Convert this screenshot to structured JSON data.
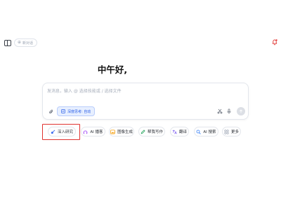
{
  "header": {
    "new_chat_label": "新对话",
    "sidebar_icon": "sidebar-toggle-icon",
    "notification_icon": "bell-icon"
  },
  "greeting": "中午好,",
  "composer": {
    "placeholder": "发消息，输入 @ 选择技能或 / 选择文件",
    "deep_think_label": "深度思考: 自动",
    "attach_icon": "paperclip-icon",
    "scissors_icon": "scissors-icon",
    "mic_icon": "microphone-icon",
    "send_icon": "send-icon"
  },
  "actions": [
    {
      "label": "深入研究",
      "icon": "research-icon",
      "color": "#3b6cf0"
    },
    {
      "label": "AI 播客",
      "icon": "podcast-icon",
      "color": "#a855f7"
    },
    {
      "label": "图像生成",
      "icon": "image-icon",
      "color": "#f59e0b"
    },
    {
      "label": "帮我写作",
      "icon": "pen-icon",
      "color": "#22a35a"
    },
    {
      "label": "翻译",
      "icon": "translate-icon",
      "color": "#7c5cf0"
    },
    {
      "label": "AI 搜索",
      "icon": "search-icon",
      "color": "#3b82f6"
    },
    {
      "label": "更多",
      "icon": "more-icon",
      "color": "#8a94a6"
    }
  ],
  "highlight_color": "#e0322f"
}
